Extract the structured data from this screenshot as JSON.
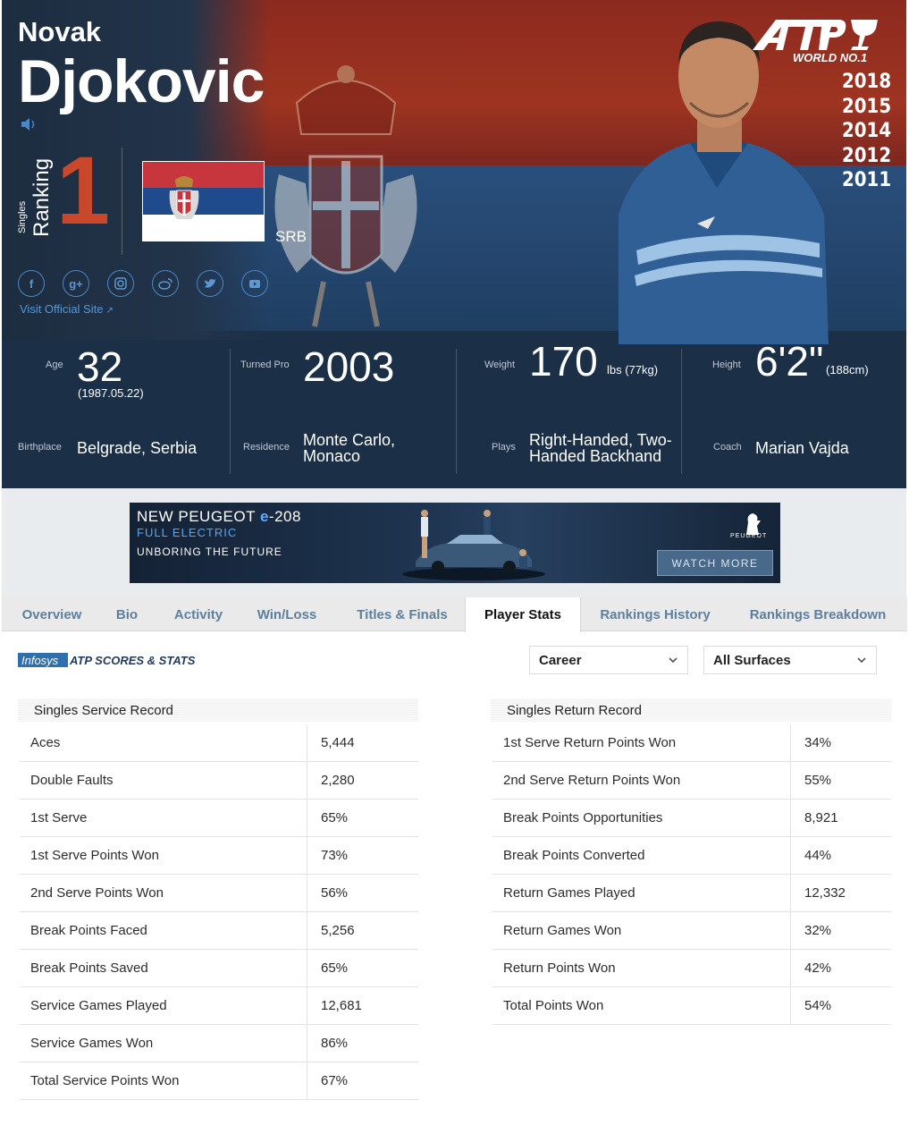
{
  "player": {
    "first_name": "Novak",
    "last_name": "Djokovic",
    "ranking_prefix": "Singles",
    "ranking_label": "Ranking",
    "ranking": "1",
    "country": "SRB",
    "visit_site": "Visit Official Site",
    "socials": [
      "facebook-icon",
      "google-plus-icon",
      "instagram-icon",
      "weibo-icon",
      "twitter-icon",
      "youtube-icon"
    ]
  },
  "atp": {
    "world_no1": "WORLD NO.1",
    "years": [
      "2018",
      "2015",
      "2014",
      "2012",
      "2011"
    ]
  },
  "bio": {
    "age_label": "Age",
    "age": "32",
    "birthdate": "(1987.05.22)",
    "turned_pro_label": "Turned Pro",
    "turned_pro": "2003",
    "weight_label": "Weight",
    "weight": "170",
    "weight_unit": "lbs (77kg)",
    "height_label": "Height",
    "height": "6'2\"",
    "height_metric": "(188cm)",
    "birthplace_label": "Birthplace",
    "birthplace": "Belgrade, Serbia",
    "residence_label": "Residence",
    "residence_line1": "Monte Carlo,",
    "residence_line2": "Monaco",
    "plays_label": "Plays",
    "plays_line1": "Right-Handed, Two-",
    "plays_line2": "Handed Backhand",
    "coach_label": "Coach",
    "coach": "Marian Vajda"
  },
  "ad": {
    "title_prefix": "NEW PEUGEOT ",
    "title_e": "e",
    "title_suffix": "-208",
    "subtitle": "FULL ELECTRIC",
    "tagline": "UNBORING THE FUTURE",
    "brand": "PEUGEOT",
    "cta": "WATCH MORE"
  },
  "tabs": [
    "Overview",
    "Bio",
    "Activity",
    "Win/Loss",
    "Titles & Finals",
    "Player Stats",
    "Rankings History",
    "Rankings Breakdown"
  ],
  "active_tab": "Player Stats",
  "filters": {
    "period": "Career",
    "surface": "All Surfaces"
  },
  "service": {
    "title": "Singles Service Record",
    "rows": [
      {
        "label": "Aces",
        "value": "5,444"
      },
      {
        "label": "Double Faults",
        "value": "2,280"
      },
      {
        "label": "1st Serve",
        "value": "65%"
      },
      {
        "label": "1st Serve Points Won",
        "value": "73%"
      },
      {
        "label": "2nd Serve Points Won",
        "value": "56%"
      },
      {
        "label": "Break Points Faced",
        "value": "5,256"
      },
      {
        "label": "Break Points Saved",
        "value": "65%"
      },
      {
        "label": "Service Games Played",
        "value": "12,681"
      },
      {
        "label": "Service Games Won",
        "value": "86%"
      },
      {
        "label": "Total Service Points Won",
        "value": "67%"
      }
    ]
  },
  "return": {
    "title": "Singles Return Record",
    "rows": [
      {
        "label": "1st Serve Return Points Won",
        "value": "34%"
      },
      {
        "label": "2nd Serve Return Points Won",
        "value": "55%"
      },
      {
        "label": "Break Points Opportunities",
        "value": "8,921"
      },
      {
        "label": "Break Points Converted",
        "value": "44%"
      },
      {
        "label": "Return Games Played",
        "value": "12,332"
      },
      {
        "label": "Return Games Won",
        "value": "32%"
      },
      {
        "label": "Return Points Won",
        "value": "42%"
      },
      {
        "label": "Total Points Won",
        "value": "54%"
      }
    ]
  },
  "colors": {
    "rank_number": "#c9482b",
    "tab_text": "#5d7f9e",
    "link": "#4d9ae6",
    "hero_red": "#9e3421",
    "hero_blue": "#1f3d60"
  }
}
